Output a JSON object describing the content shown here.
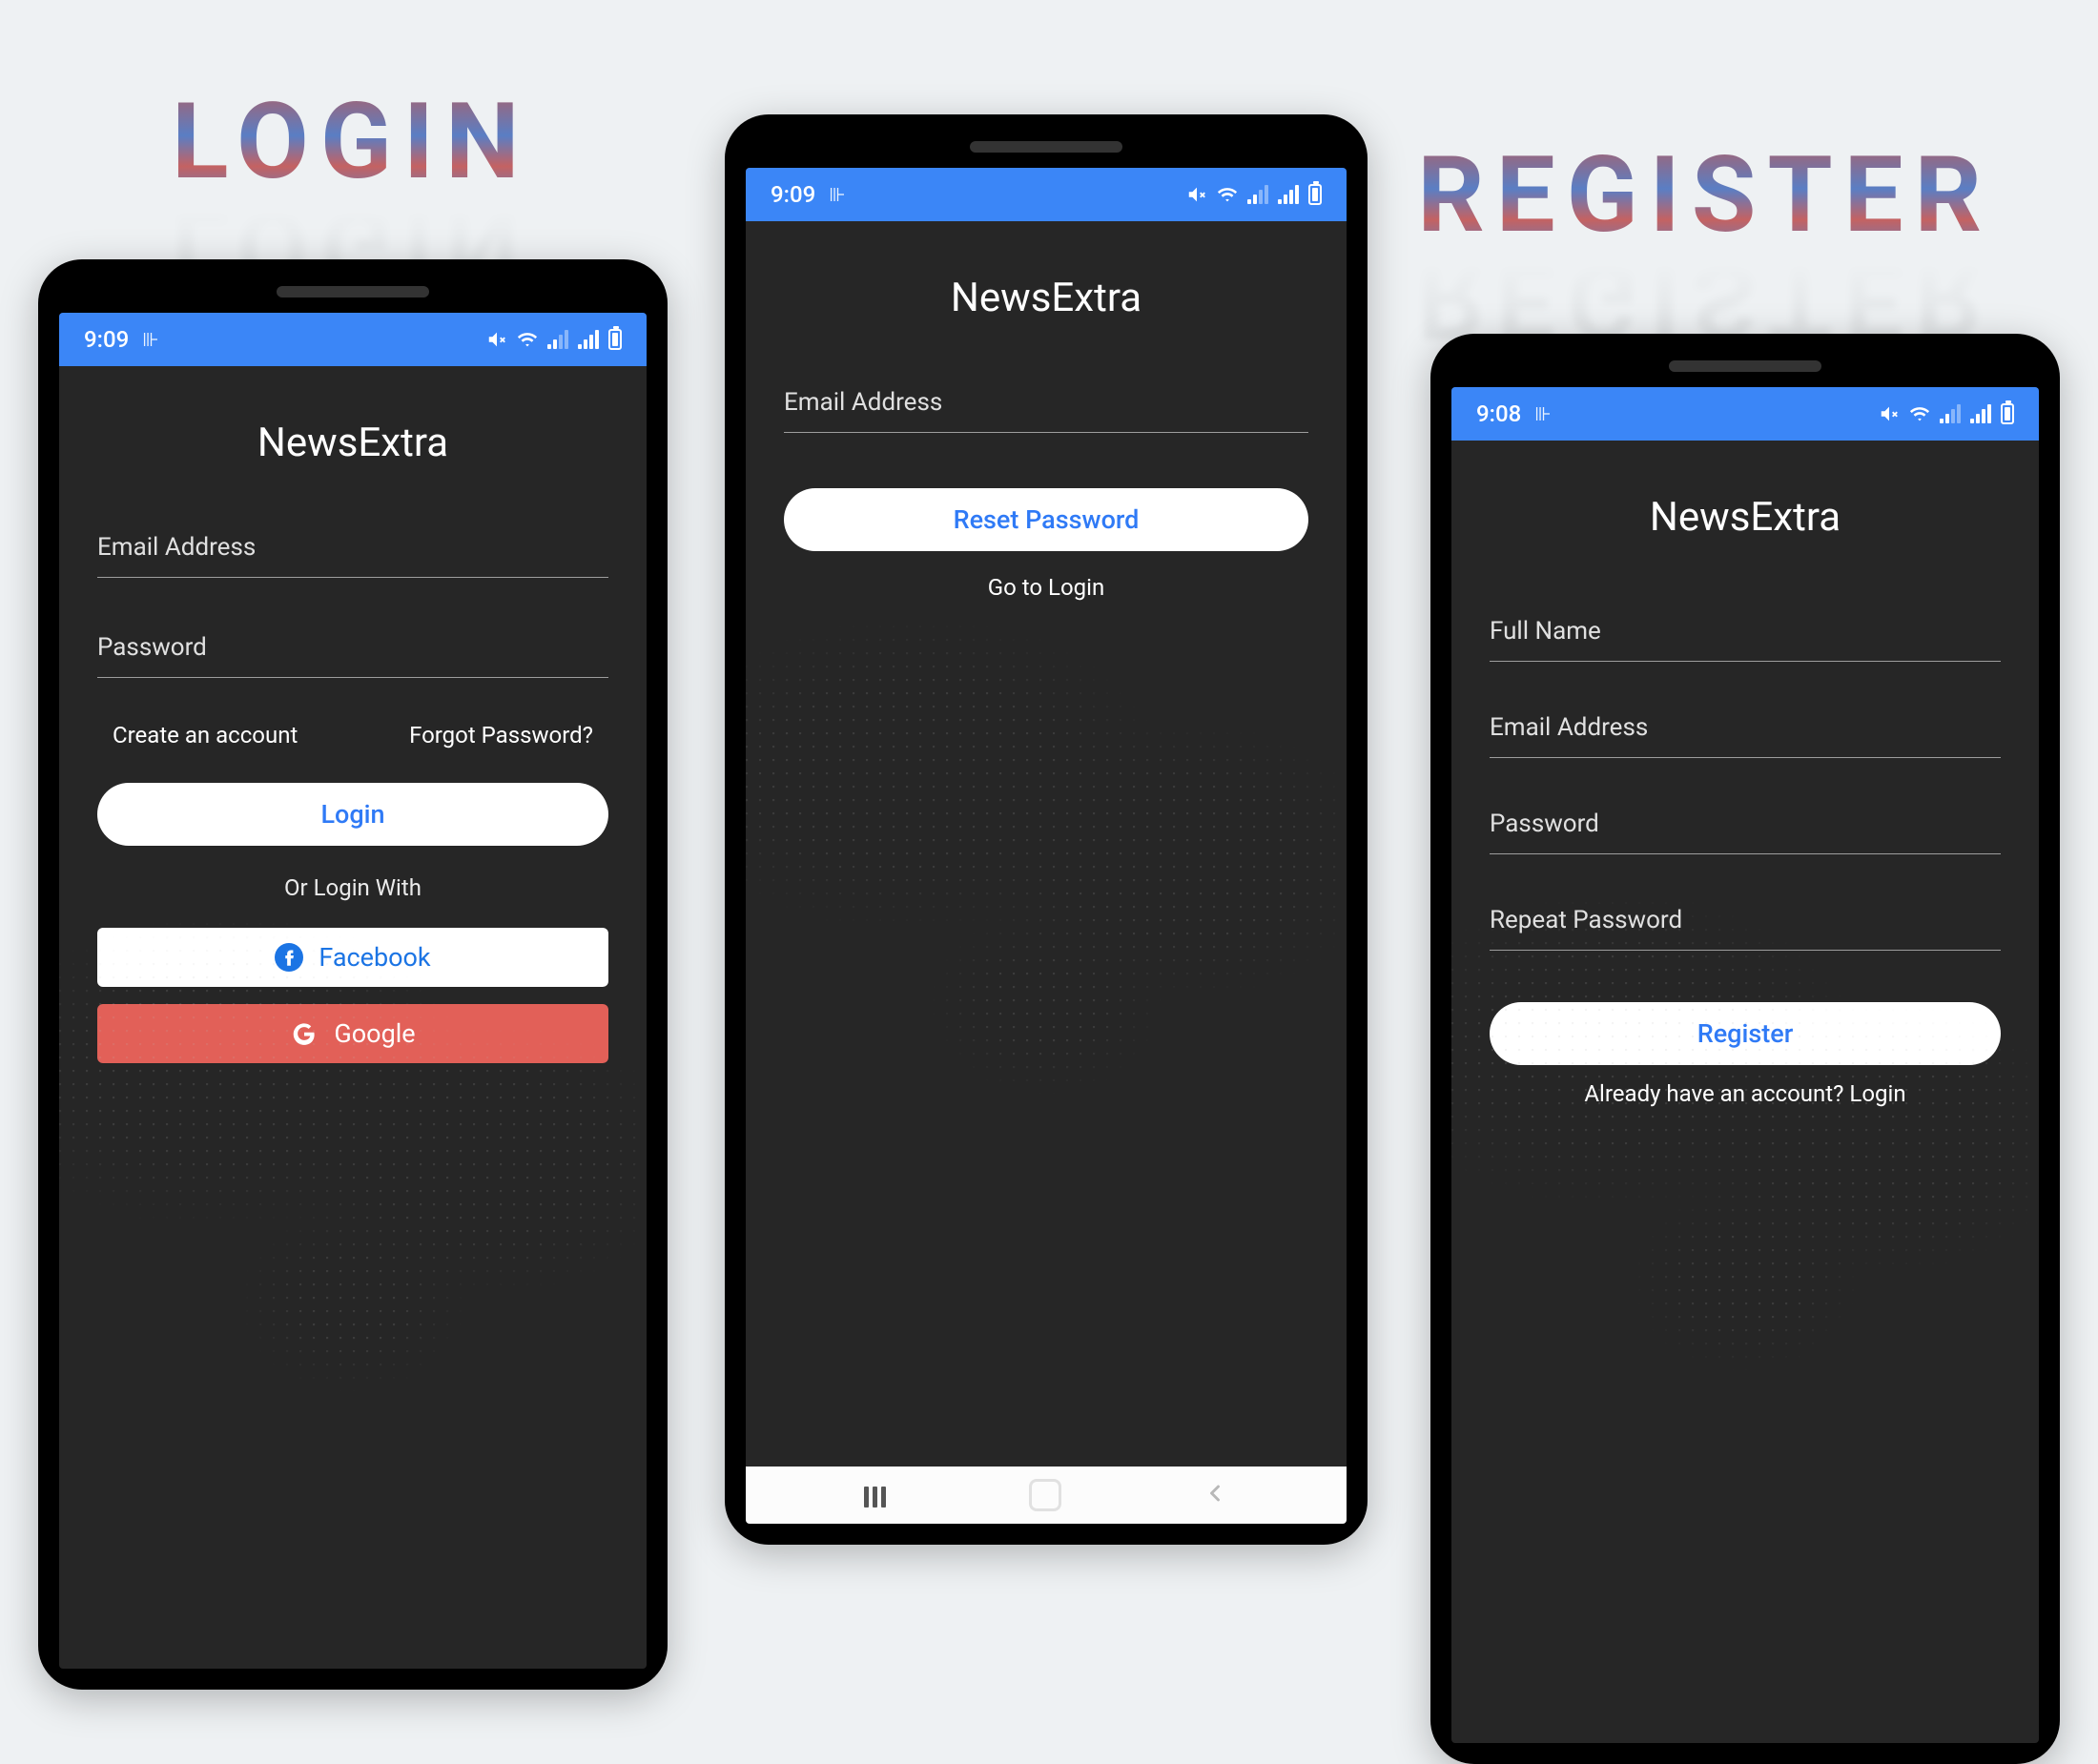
{
  "banners": {
    "login": "LOGIN",
    "register": "REGISTER"
  },
  "app_name": "NewsExtra",
  "colors": {
    "accent_blue": "#3b86f7",
    "button_text_blue": "#2f7af6",
    "google_red": "#e26058",
    "screen_bg": "#262626"
  },
  "status": {
    "time_login": "9:09",
    "time_reset": "9:09",
    "time_register": "9:08"
  },
  "login_screen": {
    "fields": {
      "email": "Email Address",
      "password": "Password"
    },
    "create_account": "Create an account",
    "forgot_password": "Forgot Password?",
    "login_button": "Login",
    "or_login_with": "Or Login With",
    "facebook": "Facebook",
    "google": "Google"
  },
  "reset_screen": {
    "fields": {
      "email": "Email Address"
    },
    "reset_button": "Reset Password",
    "go_to_login": "Go to Login"
  },
  "register_screen": {
    "fields": {
      "full_name": "Full Name",
      "email": "Email Address",
      "password": "Password",
      "repeat_password": "Repeat Password"
    },
    "register_button": "Register",
    "already_have_account": "Already have an account? Login"
  }
}
